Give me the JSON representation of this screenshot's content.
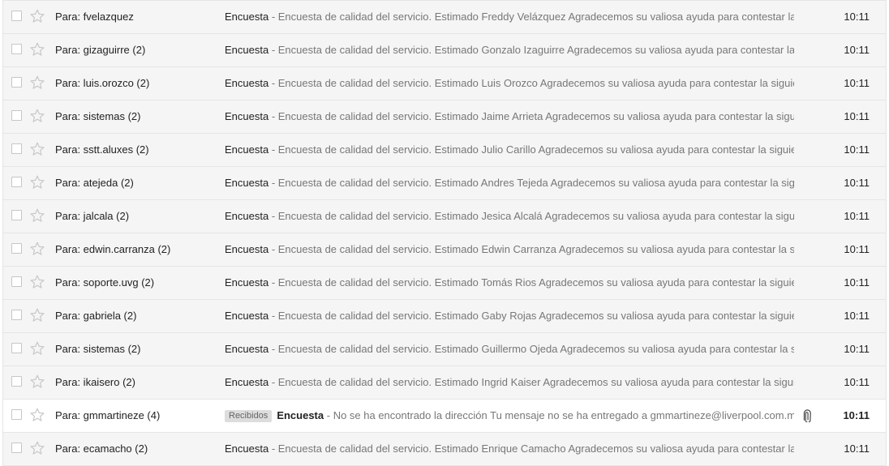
{
  "colors": {
    "read_row_bg": "#f5f5f5",
    "unread_row_bg": "#ffffff",
    "snippet": "#777777"
  },
  "separator": " - ",
  "rows": [
    {
      "sender": "Para: fvelazquez",
      "label": "",
      "subject": "Encuesta",
      "snippet": "Encuesta de calidad del servicio. Estimado Freddy Velázquez Agradecemos su valiosa ayuda para contestar la s",
      "time": "10:11",
      "unread": false,
      "attachment": false
    },
    {
      "sender": "Para: gizaguirre (2)",
      "label": "",
      "subject": "Encuesta",
      "snippet": "Encuesta de calidad del servicio. Estimado Gonzalo Izaguirre Agradecemos su valiosa ayuda para contestar la s",
      "time": "10:11",
      "unread": false,
      "attachment": false
    },
    {
      "sender": "Para: luis.orozco (2)",
      "label": "",
      "subject": "Encuesta",
      "snippet": "Encuesta de calidad del servicio. Estimado Luis Orozco Agradecemos su valiosa ayuda para contestar la siguien",
      "time": "10:11",
      "unread": false,
      "attachment": false
    },
    {
      "sender": "Para: sistemas (2)",
      "label": "",
      "subject": "Encuesta",
      "snippet": "Encuesta de calidad del servicio. Estimado Jaime Arrieta Agradecemos su valiosa ayuda para contestar la siguie",
      "time": "10:11",
      "unread": false,
      "attachment": false
    },
    {
      "sender": "Para: sstt.aluxes (2)",
      "label": "",
      "subject": "Encuesta",
      "snippet": "Encuesta de calidad del servicio. Estimado Julio Carillo Agradecemos su valiosa ayuda para contestar la siguien",
      "time": "10:11",
      "unread": false,
      "attachment": false
    },
    {
      "sender": "Para: atejeda (2)",
      "label": "",
      "subject": "Encuesta",
      "snippet": "Encuesta de calidad del servicio. Estimado Andres Tejeda Agradecemos su valiosa ayuda para contestar la sigu",
      "time": "10:11",
      "unread": false,
      "attachment": false
    },
    {
      "sender": "Para: jalcala (2)",
      "label": "",
      "subject": "Encuesta",
      "snippet": "Encuesta de calidad del servicio. Estimado Jesica Alcalá Agradecemos su valiosa ayuda para contestar la siguie",
      "time": "10:11",
      "unread": false,
      "attachment": false
    },
    {
      "sender": "Para: edwin.carranza (2)",
      "label": "",
      "subject": "Encuesta",
      "snippet": "Encuesta de calidad del servicio. Estimado Edwin Carranza Agradecemos su valiosa ayuda para contestar la sig",
      "time": "10:11",
      "unread": false,
      "attachment": false
    },
    {
      "sender": "Para: soporte.uvg (2)",
      "label": "",
      "subject": "Encuesta",
      "snippet": "Encuesta de calidad del servicio. Estimado Tomás Rios Agradecemos su valiosa ayuda para contestar la siguien",
      "time": "10:11",
      "unread": false,
      "attachment": false
    },
    {
      "sender": "Para: gabriela (2)",
      "label": "",
      "subject": "Encuesta",
      "snippet": "Encuesta de calidad del servicio. Estimado Gaby Rojas Agradecemos su valiosa ayuda para contestar la siguien",
      "time": "10:11",
      "unread": false,
      "attachment": false
    },
    {
      "sender": "Para: sistemas (2)",
      "label": "",
      "subject": "Encuesta",
      "snippet": "Encuesta de calidad del servicio. Estimado Guillermo Ojeda Agradecemos su valiosa ayuda para contestar la sig",
      "time": "10:11",
      "unread": false,
      "attachment": false
    },
    {
      "sender": "Para: ikaisero (2)",
      "label": "",
      "subject": "Encuesta",
      "snippet": "Encuesta de calidad del servicio. Estimado Ingrid Kaiser Agradecemos su valiosa ayuda para contestar la siguie",
      "time": "10:11",
      "unread": false,
      "attachment": false
    },
    {
      "sender": "Para: gmmartineze (4)",
      "label": "Recibidos",
      "subject": "Encuesta",
      "snippet": "No se ha encontrado la dirección Tu mensaje no se ha entregado a gmmartineze@liverpool.com.mx",
      "time": "10:11",
      "unread": true,
      "attachment": true
    },
    {
      "sender": "Para: ecamacho (2)",
      "label": "",
      "subject": "Encuesta",
      "snippet": "Encuesta de calidad del servicio. Estimado Enrique Camacho Agradecemos su valiosa ayuda para contestar la s",
      "time": "10:11",
      "unread": false,
      "attachment": false
    }
  ]
}
